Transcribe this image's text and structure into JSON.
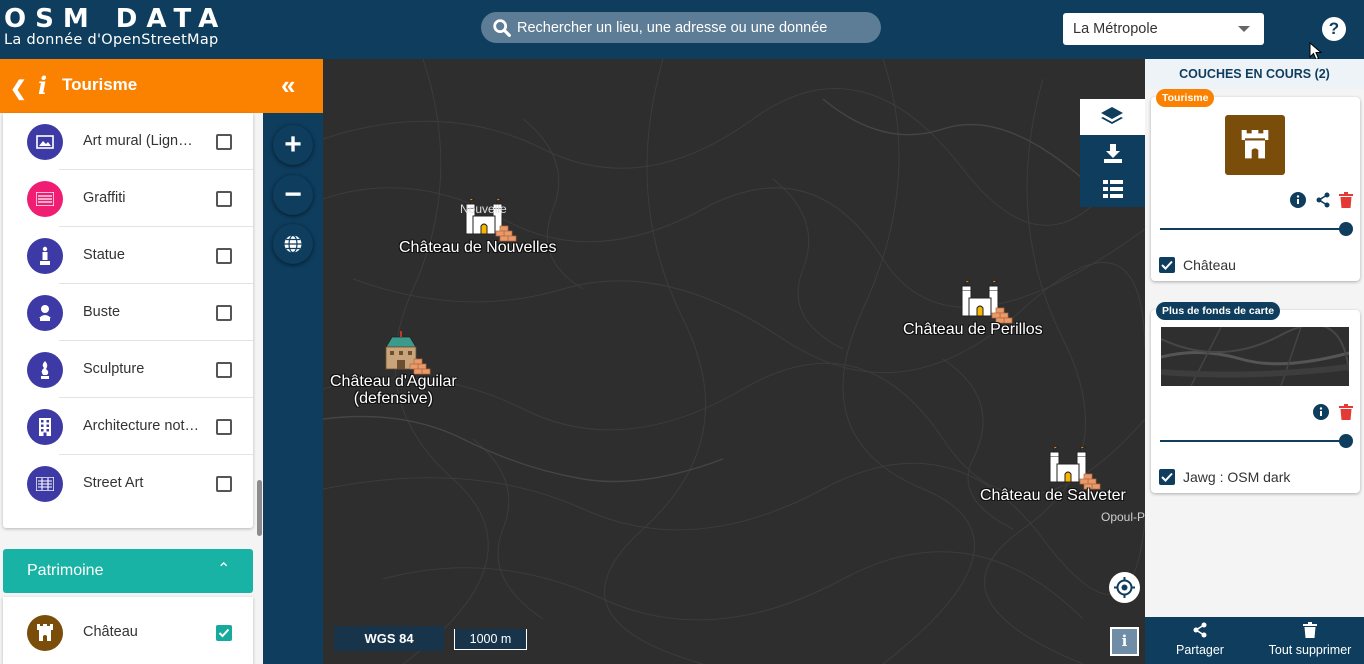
{
  "header": {
    "logo_title": "OSM DATA",
    "logo_subtitle": "La donnée  d'OpenStreetMap",
    "search_placeholder": "Rechercher un lieu, une adresse ou une donnée",
    "region_selected": "La Métropole",
    "help_label": "?"
  },
  "left_panel": {
    "title": "Tourisme",
    "back_icon": "chevron-left-icon",
    "info_icon": "info-icon",
    "collapse_icon": "double-chevron-left-icon",
    "items": [
      {
        "label": "Art mural (Lign…",
        "icon": "mural-icon",
        "color": "#3d3aa6",
        "checked": false
      },
      {
        "label": "Graffiti",
        "icon": "graffiti-icon",
        "color": "#ef1e73",
        "checked": false
      },
      {
        "label": "Statue",
        "icon": "statue-icon",
        "color": "#3d3aa6",
        "checked": false
      },
      {
        "label": "Buste",
        "icon": "bust-icon",
        "color": "#3d3aa6",
        "checked": false
      },
      {
        "label": "Sculpture",
        "icon": "sculpture-icon",
        "color": "#3d3aa6",
        "checked": false
      },
      {
        "label": "Architecture not…",
        "icon": "building-icon",
        "color": "#3d3aa6",
        "checked": false
      },
      {
        "label": "Street Art",
        "icon": "street-art-icon",
        "color": "#3d3aa6",
        "checked": false
      }
    ],
    "section": {
      "label": "Patrimoine",
      "color": "#19b3a6"
    },
    "section_items": [
      {
        "label": "Château",
        "icon": "castle-icon",
        "color": "#7a4d0b",
        "checked": true
      }
    ]
  },
  "map": {
    "labels": [
      {
        "text": "Château de Nouvelles"
      },
      {
        "text": "Château de Perillos"
      },
      {
        "text": "Château d'Aguilar\n(defensive)"
      },
      {
        "text": "Château de Salveter"
      }
    ],
    "small_labels": [
      "Nouvelle",
      "Opoul-P"
    ],
    "projection": "WGS 84",
    "scale": "1000 m",
    "info_label": "i"
  },
  "layers_panel": {
    "title": "COUCHES EN COURS (2)",
    "layers": [
      {
        "tag": "Tourisme",
        "tag_color": "#fb8200",
        "item_label": "Château",
        "checked": true
      },
      {
        "tag": "Plus de fonds de carte",
        "tag_color": "#0e3d5e",
        "item_label": "Jawg : OSM dark",
        "checked": true
      }
    ],
    "footer": {
      "share_label": "Partager",
      "delete_all_label": "Tout supprimer"
    }
  }
}
